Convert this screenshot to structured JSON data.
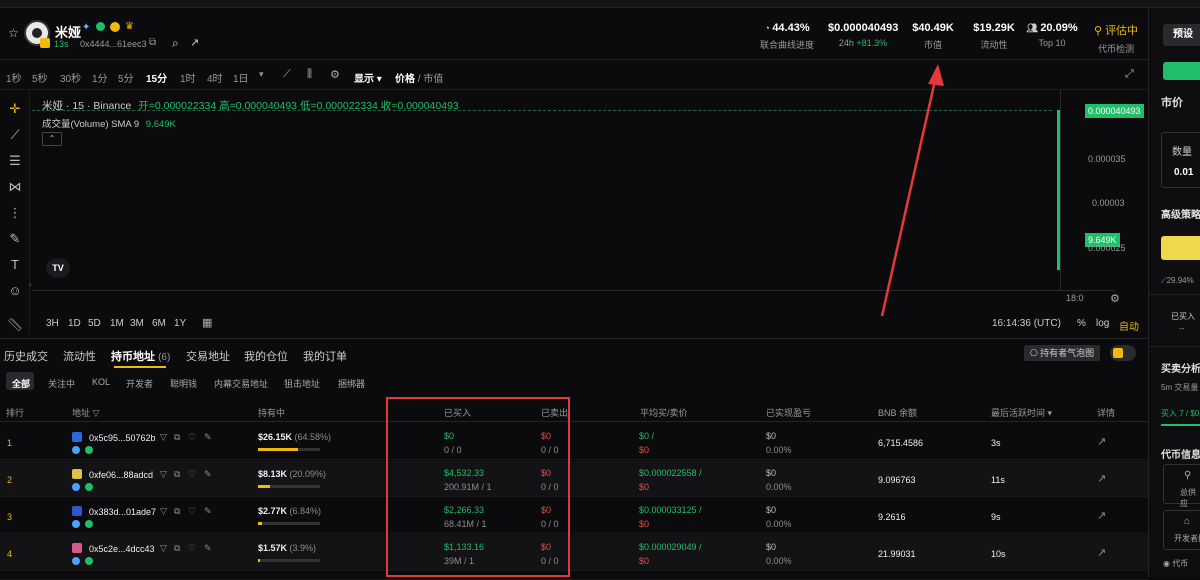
{
  "header": {
    "token_name": "米娅",
    "age": "13s",
    "address": "0x4444...61eec3",
    "stats": [
      {
        "value": "44.43%",
        "label": "联合曲线进度"
      },
      {
        "value": "$0.000040493",
        "label": "24h",
        "change": "+81.3%"
      },
      {
        "value": "$40.49K",
        "label": "市值"
      },
      {
        "value": "$19.29K",
        "label": "流动性"
      },
      {
        "value": "20.09%",
        "label": "Top 10"
      },
      {
        "value": "评估中",
        "label": "代币检测"
      }
    ]
  },
  "timeframes": [
    "1秒",
    "5秒",
    "30秒",
    "1分",
    "5分",
    "15分",
    "1时",
    "4时",
    "1日"
  ],
  "active_timeframe": "15分",
  "toolbar_extra": {
    "display": "显示",
    "price": "价格",
    "mcap": "市值"
  },
  "chart": {
    "legend": "米娅 · 15 · Binance",
    "ohlc": "开=0.000022334 高=0.000040493 低=0.000022334 收=0.000040493",
    "volume_label": "成交量(Volume) SMA 9",
    "volume_value": "9.649K",
    "price_tag": "0.000040493",
    "vol_tag": "9.649K",
    "yticks": [
      "0.000035",
      "0.00003",
      "0.000025"
    ],
    "x_tick": "18:0",
    "ranges": [
      "3H",
      "1D",
      "5D",
      "1M",
      "3M",
      "6M",
      "1Y"
    ],
    "clock": "16:14:36 (UTC)",
    "pct": "%",
    "log": "log",
    "auto": "自动"
  },
  "tabs": [
    {
      "label": "历史成交"
    },
    {
      "label": "流动性"
    },
    {
      "label": "持币地址",
      "count": "(6)"
    },
    {
      "label": "交易地址"
    },
    {
      "label": "我的仓位"
    },
    {
      "label": "我的订单"
    }
  ],
  "bubble_button": "持有者气泡图",
  "filters": [
    "全部",
    "关注中",
    "KOL",
    "开发者",
    "聪明钱",
    "内幕交易地址",
    "狙击地址",
    "捆绑器"
  ],
  "table": {
    "headers": [
      "排行",
      "地址",
      "持有中",
      "已买入",
      "已卖出",
      "平均买/卖价",
      "已实现盈亏",
      "BNB 余额",
      "最后活跃时间",
      "详情"
    ],
    "rows": [
      {
        "rank": "1",
        "addr": "0x5c95...50762b",
        "hold": "$26.15K",
        "hold_pct": "(64.58%)",
        "hold_frac": 0.6458,
        "buy": "$0",
        "buy_sub": "0 / 0",
        "sell": "$0",
        "sell_sub": "0 / 0",
        "avg_buy": "$0 /",
        "avg_sell": "$0",
        "pnl": "$0",
        "pnl_pct": "0.00%",
        "bnb": "6,715.4586",
        "active": "3s"
      },
      {
        "rank": "2",
        "addr": "0xfe06...88adcd",
        "hold": "$8.13K",
        "hold_pct": "(20.09%)",
        "hold_frac": 0.2009,
        "buy": "$4,532.33",
        "buy_sub": "200.91M / 1",
        "sell": "$0",
        "sell_sub": "0 / 0",
        "avg_buy": "$0.000022558 /",
        "avg_sell": "$0",
        "pnl": "$0",
        "pnl_pct": "0.00%",
        "bnb": "9.096763",
        "active": "11s"
      },
      {
        "rank": "3",
        "addr": "0x383d...01ade7",
        "hold": "$2.77K",
        "hold_pct": "(6.84%)",
        "hold_frac": 0.0684,
        "buy": "$2,266.33",
        "buy_sub": "68.41M / 1",
        "sell": "$0",
        "sell_sub": "0 / 0",
        "avg_buy": "$0.000033125 /",
        "avg_sell": "$0",
        "pnl": "$0",
        "pnl_pct": "0.00%",
        "bnb": "9.2616",
        "active": "9s"
      },
      {
        "rank": "4",
        "addr": "0x5c2e...4dcc43",
        "hold": "$1.57K",
        "hold_pct": "(3.9%)",
        "hold_frac": 0.039,
        "buy": "$1,133.16",
        "buy_sub": "39M / 1",
        "sell": "$0",
        "sell_sub": "0 / 0",
        "avg_buy": "$0.000029049 /",
        "avg_sell": "$0",
        "pnl": "$0",
        "pnl_pct": "0.00%",
        "bnb": "21.99031",
        "active": "10s"
      }
    ]
  },
  "right": {
    "preset": "预设",
    "market": "市价",
    "qty_label": "数量",
    "qty_value": "0.01",
    "advanced": "高级策略",
    "pct": "29.94%",
    "bought": "已买入",
    "dash": "--",
    "analysis": "买卖分析",
    "trade_line": "5m 交易量",
    "buy_line": "买入 7 / $0",
    "info": "代币信息",
    "holder": "总供应",
    "dev": "开发者持",
    "token_addr": "代币"
  },
  "colors": {
    "up": "#1fbf6a",
    "down": "#f04a4a",
    "accent": "#f0b90b",
    "annotation": "#e5383b"
  }
}
